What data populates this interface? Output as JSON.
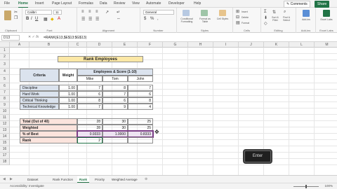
{
  "ribbon": {
    "tabs": [
      "File",
      "Home",
      "Insert",
      "Page Layout",
      "Formulas",
      "Data",
      "Review",
      "View",
      "Automate",
      "Developer",
      "Help"
    ],
    "active_tab": "Home",
    "comments_label": "Comments",
    "share_label": "Share",
    "groups": {
      "clipboard": "Clipboard",
      "font": "Font",
      "alignment": "Alignment",
      "number": "Number",
      "styles": "Styles",
      "cells": "Cells",
      "editing": "Editing",
      "addins": "Add-ins",
      "excel_labs": "Excel Labs"
    },
    "font_name": "Calibri",
    "font_size": "11",
    "number_format": "General",
    "styles_items": [
      "Conditional Formatting",
      "Format as Table",
      "Cell Styles"
    ],
    "cells_items": [
      "Insert",
      "Delete",
      "Format"
    ],
    "editing_items": [
      "Sort & Filter",
      "Find & Select"
    ],
    "addins_item": "Add-ins",
    "labs_item": "Excel Labs"
  },
  "formula_bar": {
    "name_box": "D13",
    "fx": "fx",
    "formula": "=RANK(E13,$E$13:$G$13)"
  },
  "columns": [
    "A",
    "B",
    "C",
    "D",
    "E",
    "F",
    "G",
    "H",
    "I",
    "J",
    "K",
    "L",
    "M",
    "N",
    "O",
    "P"
  ],
  "rows": [
    "1",
    "2",
    "3",
    "4",
    "5",
    "6",
    "7",
    "8",
    "9",
    "10",
    "11",
    "12",
    "13",
    "14",
    "15",
    "16",
    "17",
    "18"
  ],
  "sheet": {
    "title": "Rank Employees",
    "criteria_header": "Criteria",
    "weight_header": "Weight",
    "group_header": "Employees & Score (1-10)",
    "employees": [
      "Mike",
      "Tom",
      "John"
    ],
    "criteria": [
      {
        "name": "Discipline",
        "weight": "1.00",
        "scores": [
          "7",
          "8",
          "7"
        ]
      },
      {
        "name": "Hard Work",
        "weight": "1.00",
        "scores": [
          "6",
          "7",
          "6"
        ]
      },
      {
        "name": "Critical Thinking",
        "weight": "1.00",
        "scores": [
          "8",
          "6",
          "8"
        ]
      },
      {
        "name": "Technical Knowledge",
        "weight": "1.00",
        "scores": [
          "7",
          "9",
          "4"
        ]
      }
    ],
    "total_label": "Total (Out of 40)",
    "total": [
      "28",
      "30",
      "25"
    ],
    "weighted_label": "Weighted",
    "weighted": [
      "28",
      "30",
      "25"
    ],
    "best_label": "% of Best",
    "best": [
      "0.9333",
      "1.0000",
      "0.8333"
    ],
    "rank_label": "Rank",
    "rank": [
      "2",
      "",
      ""
    ]
  },
  "sheet_tabs": [
    "Dataset",
    "Rank Function",
    "Rank",
    "Priority",
    "Weighted Average"
  ],
  "active_sheet": "Rank",
  "status": {
    "text": "Accessibility: Investigate",
    "zoom": "100%"
  },
  "key_overlay": "Enter"
}
